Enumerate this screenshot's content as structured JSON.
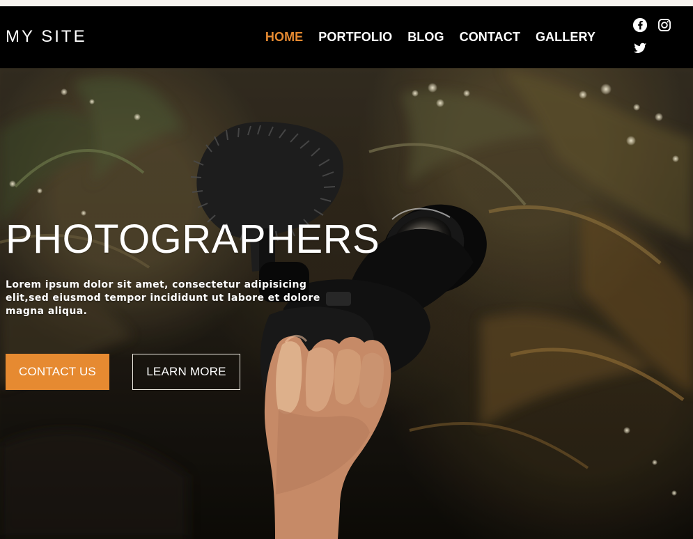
{
  "site": {
    "title": "MY SITE"
  },
  "nav": {
    "items": [
      {
        "label": "HOME"
      },
      {
        "label": "PORTFOLIO"
      },
      {
        "label": "BLOG"
      },
      {
        "label": "CONTACT"
      },
      {
        "label": "GALLERY"
      }
    ]
  },
  "social": {
    "items": [
      {
        "icon": "facebook-icon"
      },
      {
        "icon": "instagram-icon"
      },
      {
        "icon": "twitter-icon"
      }
    ]
  },
  "hero": {
    "title": "PHOTOGRAPHERS",
    "subtitle": "Lorem ipsum dolor sit amet, consectetur adipisicing elit,sed eiusmod tempor incididunt ut labore et dolore magna aliqua.",
    "primary_button": "CONTACT US",
    "secondary_button": "LEARN MORE"
  },
  "colors": {
    "accent": "#e68a31",
    "navbar": "#000000",
    "text": "#ffffff"
  }
}
